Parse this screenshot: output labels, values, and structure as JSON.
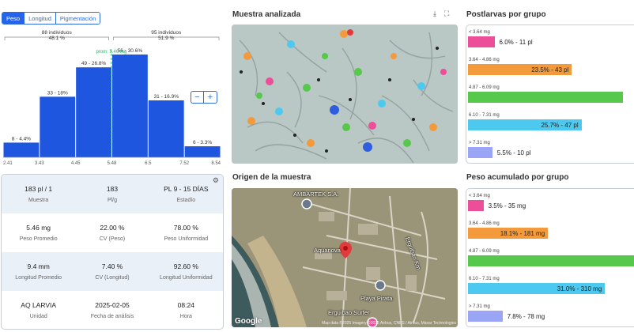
{
  "tabs": [
    "Peso",
    "Longitud",
    "Pigmentación"
  ],
  "histogram": {
    "left_group": {
      "count": "88 individuos",
      "pct": "48.1 %"
    },
    "right_group": {
      "count": "95 individuos",
      "pct": "51.9 %"
    },
    "mean_label": "prom: 5.46 mg",
    "axis_ticks": [
      "2.41",
      "3.43",
      "4.45",
      "5.48",
      "6.5",
      "7.52",
      "8.54"
    ]
  },
  "chart_data": {
    "type": "bar",
    "categories": [
      "2.41-3.43",
      "3.43-4.45",
      "4.45-5.48",
      "5.48-6.5",
      "6.5-7.52",
      "7.52-8.54"
    ],
    "values": [
      8,
      33,
      49,
      56,
      31,
      6
    ],
    "labels": [
      "8 - 4.4%",
      "33 - 18%",
      "49 - 26.8%",
      "56 - 30.6%",
      "31 - 16.9%",
      "6 - 3.3%"
    ],
    "ylim": [
      0,
      62
    ],
    "mean": 5.46,
    "color": "#1f56e0"
  },
  "zoom": {
    "minus": "−",
    "plus": "+"
  },
  "stats": {
    "rows": [
      [
        {
          "v": "183 pl / 1",
          "l": "Muestra"
        },
        {
          "v": "183",
          "l": "Pl/g"
        },
        {
          "v": "PL 9 - 15 DÍAS",
          "l": "Estadío"
        }
      ],
      [
        {
          "v": "5.46 mg",
          "l": "Peso Promedio"
        },
        {
          "v": "22.00 %",
          "l": "CV (Peso)"
        },
        {
          "v": "78.00 %",
          "l": "Peso Uniformidad"
        }
      ],
      [
        {
          "v": "9.4 mm",
          "l": "Longitud Promedio"
        },
        {
          "v": "7.40 %",
          "l": "CV (Longitud)"
        },
        {
          "v": "92.60 %",
          "l": "Longitud Uniformidad"
        }
      ],
      [
        {
          "v": "AQ LARVIA",
          "l": "Unidad"
        },
        {
          "v": "2025-02-05",
          "l": "Fecha de análisis"
        },
        {
          "v": "08:24",
          "l": "Hora"
        }
      ]
    ]
  },
  "sections": {
    "sample": "Muestra analizada",
    "origin": "Origen de la muestra",
    "postlarvas": "Postlarvas por grupo",
    "weight": "Peso acumulado por grupo"
  },
  "map": {
    "labels": {
      "ambartek": "AMBARTEK S.A.",
      "aquanova": "Aquanova",
      "playa": "Playa Pirata",
      "erguibao": "Erguibao Surfer",
      "road": "Erguibao Km"
    },
    "google": "Google",
    "attribution": "Map data ©2025 Imagery ©2025 Airbus, CNES / Airbus, Maxar Technologies"
  },
  "postlarvas": [
    {
      "range": "< 3.64 mg",
      "text": "6.0% - 11 pl",
      "frac": 0.06,
      "color": "#ec4e9a"
    },
    {
      "range": "3.64 - 4.86 mg",
      "text": "23.5% - 43 pl",
      "frac": 0.235,
      "color": "#f39a3c"
    },
    {
      "range": "4.87 - 6.09 mg",
      "text": "",
      "frac": 0.35,
      "color": "#56c84c"
    },
    {
      "range": "6.10 - 7.31 mg",
      "text": "25.7% - 47 pl",
      "frac": 0.257,
      "color": "#4dc9ef"
    },
    {
      "range": "> 7.31 mg",
      "text": "5.5% - 10 pl",
      "frac": 0.055,
      "color": "#9ba5f5"
    }
  ],
  "weight": [
    {
      "range": "< 3.64 mg",
      "text": "3.5% - 35 mg",
      "frac": 0.035,
      "color": "#ec4e9a"
    },
    {
      "range": "3.64 - 4.86 mg",
      "text": "18.1% - 181 mg",
      "frac": 0.181,
      "color": "#f39a3c"
    },
    {
      "range": "4.87 - 6.09 mg",
      "text": "",
      "frac": 0.4,
      "color": "#56c84c"
    },
    {
      "range": "6.10 - 7.31 mg",
      "text": "31.0% - 310 mg",
      "frac": 0.31,
      "color": "#4dc9ef"
    },
    {
      "range": "> 7.31 mg",
      "text": "7.8% - 78 mg",
      "frac": 0.078,
      "color": "#9ba5f5"
    }
  ]
}
